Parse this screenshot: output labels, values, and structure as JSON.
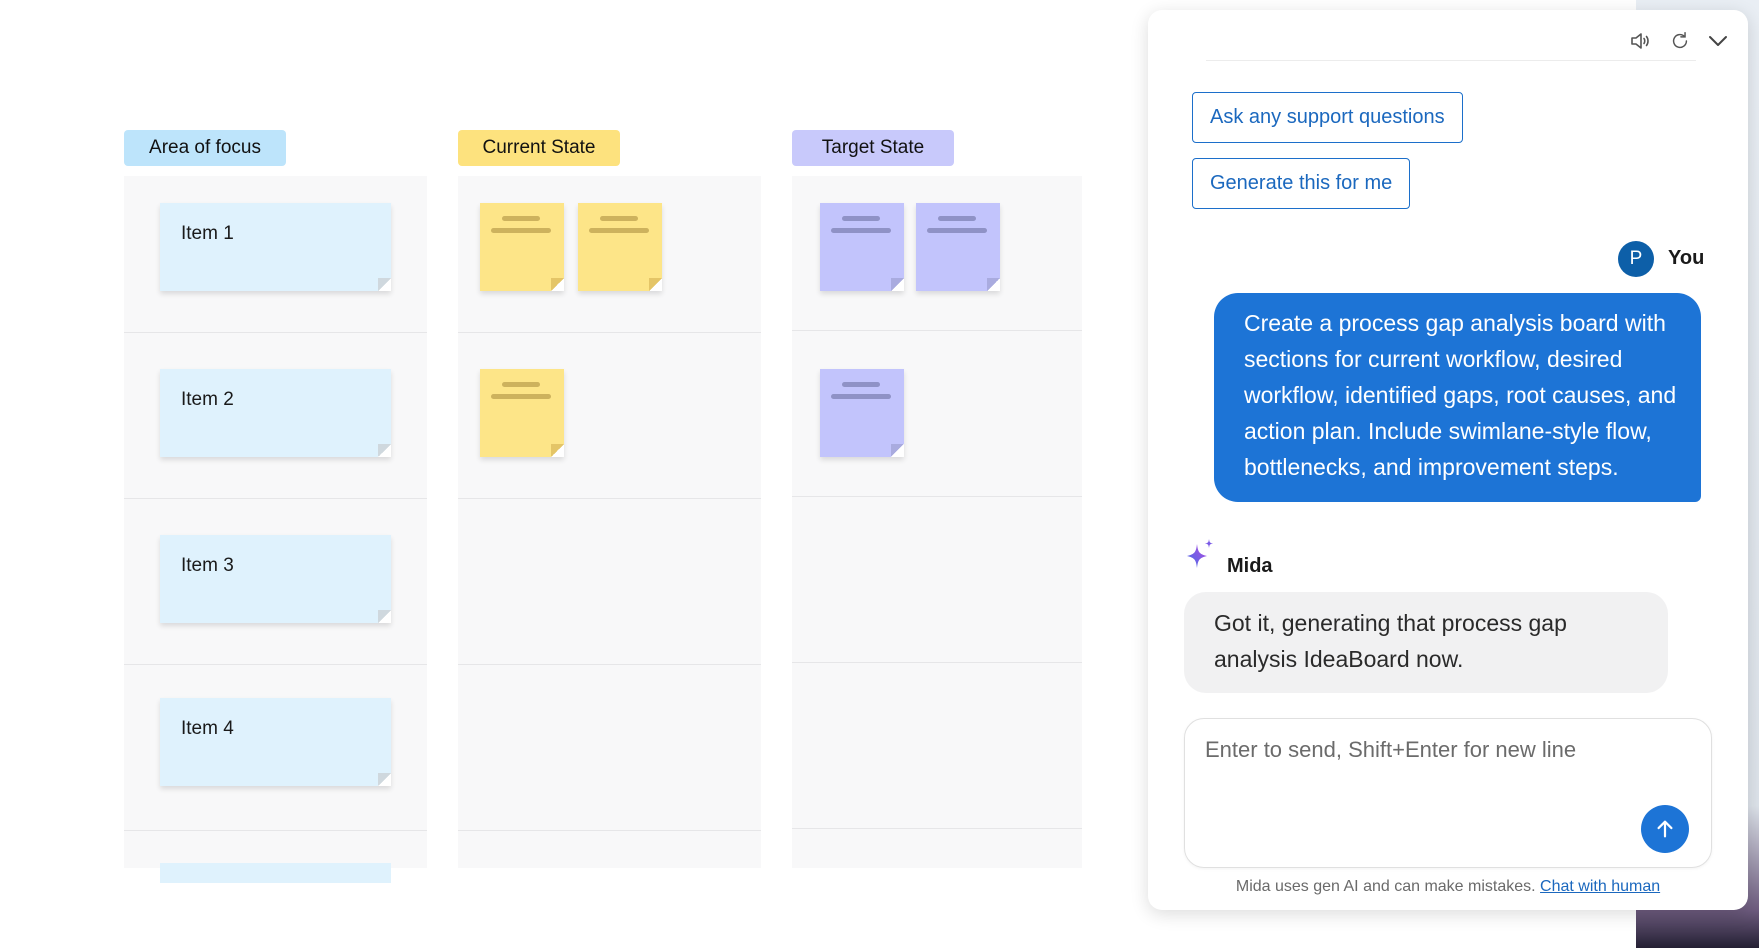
{
  "board": {
    "columns": [
      {
        "title": "Area of focus",
        "color": "#bde4fb"
      },
      {
        "title": "Current State",
        "color": "#fde27e"
      },
      {
        "title": "Target State",
        "color": "#c8c9fb"
      }
    ],
    "rows": [
      {
        "label": "Item 1",
        "current_notes": 2,
        "target_notes": 2
      },
      {
        "label": "Item 2",
        "current_notes": 1,
        "target_notes": 1
      },
      {
        "label": "Item 3",
        "current_notes": 0,
        "target_notes": 0
      },
      {
        "label": "Item 4",
        "current_notes": 0,
        "target_notes": 0
      }
    ],
    "note_colors": {
      "area": "#dff2fd",
      "current": "#fde588",
      "target": "#c2c4fc"
    }
  },
  "chat": {
    "icons": [
      "speaker-icon",
      "refresh-icon",
      "chevron-down-icon"
    ],
    "suggestions": [
      "Ask any support questions",
      "Generate this for me"
    ],
    "user": {
      "avatar_letter": "P",
      "name": "You",
      "message": "Create a process gap analysis board with sections for current workflow, desired workflow, identified gaps, root causes, and action plan. Include swimlane-style flow, bottlenecks, and improvement steps."
    },
    "bot": {
      "name": "Mida",
      "message": "Got it, generating that process gap analysis IdeaBoard now."
    },
    "input": {
      "placeholder": "Enter to send, Shift+Enter for new line",
      "value": ""
    },
    "disclaimer": {
      "text": "Mida uses gen AI and can make mistakes.",
      "link": "Chat with human"
    },
    "accent_color": "#1d74d6"
  }
}
